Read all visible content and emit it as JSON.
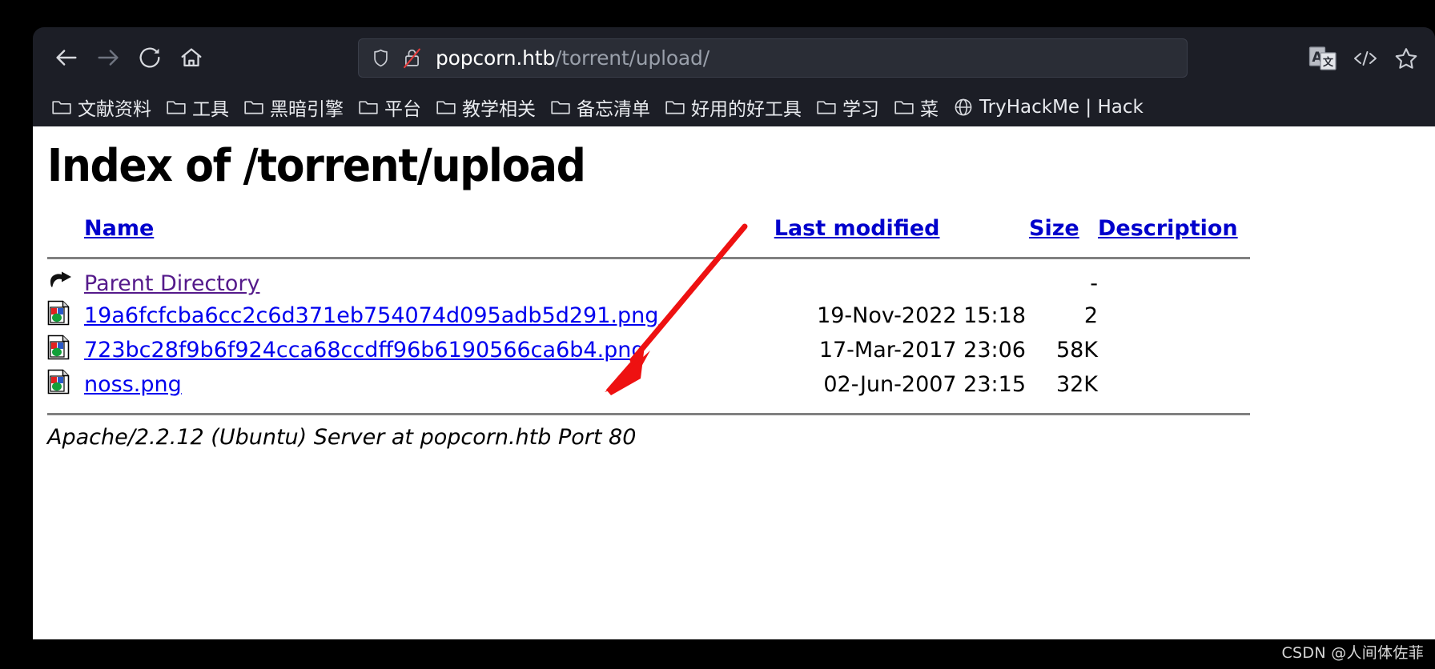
{
  "browser": {
    "nav": {
      "back_label": "Back",
      "forward_label": "Forward",
      "reload_label": "Reload",
      "home_label": "Home"
    },
    "urlbar": {
      "host": "popcorn.htb",
      "path": "/torrent/upload/",
      "shield_icon": "shield-icon",
      "security_icon": "lock-crossed-icon"
    },
    "toolbar_right": [
      {
        "icon": "translate-icon",
        "label": "Translate this page"
      },
      {
        "icon": "code-icon",
        "label": "Reader / code view"
      },
      {
        "icon": "star-icon",
        "label": "Bookmark this page"
      }
    ],
    "bookmarks": [
      {
        "label": "文献资料",
        "icon": "folder-icon"
      },
      {
        "label": "工具",
        "icon": "folder-icon"
      },
      {
        "label": "黑暗引擎",
        "icon": "folder-icon"
      },
      {
        "label": "平台",
        "icon": "folder-icon"
      },
      {
        "label": "教学相关",
        "icon": "folder-icon"
      },
      {
        "label": "备忘清单",
        "icon": "folder-icon"
      },
      {
        "label": "好用的好工具",
        "icon": "folder-icon"
      },
      {
        "label": "学习",
        "icon": "folder-icon"
      },
      {
        "label": "菜",
        "icon": "folder-icon"
      },
      {
        "label": "TryHackMe | Hack",
        "icon": "globe-icon"
      }
    ]
  },
  "page": {
    "title": "Index of /torrent/upload",
    "columns": {
      "name": "Name",
      "last_modified": "Last modified",
      "size": "Size",
      "description": "Description"
    },
    "rows": [
      {
        "icon": "parent-directory-icon",
        "name": "Parent Directory",
        "date": "",
        "size": "-",
        "description": "",
        "visited": true
      },
      {
        "icon": "image-file-icon",
        "name": "19a6fcfcba6cc2c6d371eb754074d095adb5d291.png",
        "date": "19-Nov-2022 15:18",
        "size": "2",
        "description": "",
        "visited": false
      },
      {
        "icon": "image-file-icon",
        "name": "723bc28f9b6f924cca68ccdff96b6190566ca6b4.png",
        "date": "17-Mar-2017 23:06",
        "size": "58K",
        "description": "",
        "visited": false
      },
      {
        "icon": "image-file-icon",
        "name": "noss.png",
        "date": "02-Jun-2007 23:15",
        "size": "32K",
        "description": "",
        "visited": false
      }
    ],
    "footer": "Apache/2.2.12 (Ubuntu) Server at popcorn.htb Port 80"
  },
  "annotation": {
    "arrow_color": "#ee1111",
    "arrow_label": "red-arrow-pointing-to-uploaded-file"
  },
  "watermark": "CSDN @人间体佐菲",
  "colors": {
    "chrome_bg": "#1c1e26",
    "urlbar_bg": "#2a2d36",
    "link": "#0000ee",
    "visited_link": "#551a8b",
    "header_link": "#0000cc",
    "page_bg": "#ffffff"
  }
}
